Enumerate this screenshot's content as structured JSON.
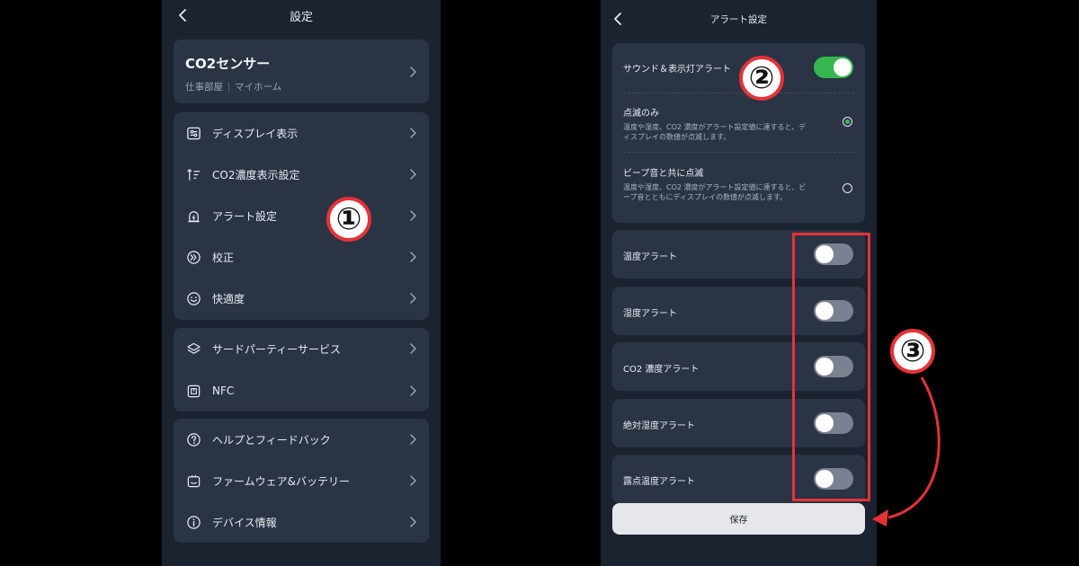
{
  "left": {
    "title": "設定",
    "device": {
      "name": "CO2センサー",
      "room": "仕事部屋",
      "home": "マイホーム"
    },
    "group1": [
      {
        "label": "ディスプレイ表示",
        "icon": "display-settings-icon"
      },
      {
        "label": "CO2濃度表示設定",
        "icon": "sort-icon"
      },
      {
        "label": "アラート設定",
        "icon": "alert-icon"
      },
      {
        "label": "校正",
        "icon": "calibration-icon"
      },
      {
        "label": "快適度",
        "icon": "smiley-icon"
      }
    ],
    "group2": [
      {
        "label": "サードパーティーサービス",
        "icon": "layers-icon"
      },
      {
        "label": "NFC",
        "icon": "nfc-icon"
      }
    ],
    "group3": [
      {
        "label": "ヘルプとフィードバック",
        "icon": "help-icon"
      },
      {
        "label": "ファームウェア&バッテリー",
        "icon": "firmware-icon"
      },
      {
        "label": "デバイス情報",
        "icon": "info-icon"
      }
    ]
  },
  "right": {
    "title": "アラート設定",
    "sound_alert": {
      "label": "サウンド＆表示灯アラート",
      "enabled": true
    },
    "options": [
      {
        "title": "点滅のみ",
        "desc": "温度や湿度、CO2 濃度がアラート設定値に達すると、ディスプレイの数値が点滅します。",
        "selected": true
      },
      {
        "title": "ビープ音と共に点滅",
        "desc": "温度や湿度、CO2 濃度がアラート設定値に達すると、ビープ音とともにディスプレイの数値が点滅します。",
        "selected": false
      }
    ],
    "alerts": [
      {
        "label": "温度アラート",
        "enabled": false
      },
      {
        "label": "湿度アラート",
        "enabled": false
      },
      {
        "label": "CO2 濃度アラート",
        "enabled": false
      },
      {
        "label": "絶対湿度アラート",
        "enabled": false
      },
      {
        "label": "露点温度アラート",
        "enabled": false
      }
    ],
    "save_label": "保存"
  },
  "annotations": {
    "badge1": "①",
    "badge2": "②",
    "badge3": "③"
  },
  "colors": {
    "background": "#1b2330",
    "card": "#2a3444",
    "toggle_on": "#35b64f",
    "toggle_off": "#7b8190",
    "annotation": "#e53238"
  }
}
